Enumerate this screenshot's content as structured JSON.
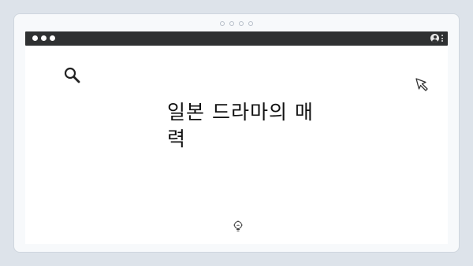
{
  "article": {
    "title": "일본 드라마의 매력"
  },
  "icons": {
    "search": "search-icon",
    "cursor": "cursor-arrow-icon",
    "bulb": "lightbulb-icon",
    "profile": "profile-icon",
    "menu": "kebab-menu-icon"
  },
  "colors": {
    "page_bg": "#dde3ea",
    "browser_bar": "#2f3132",
    "content_bg": "#ffffff",
    "text": "#111111"
  }
}
